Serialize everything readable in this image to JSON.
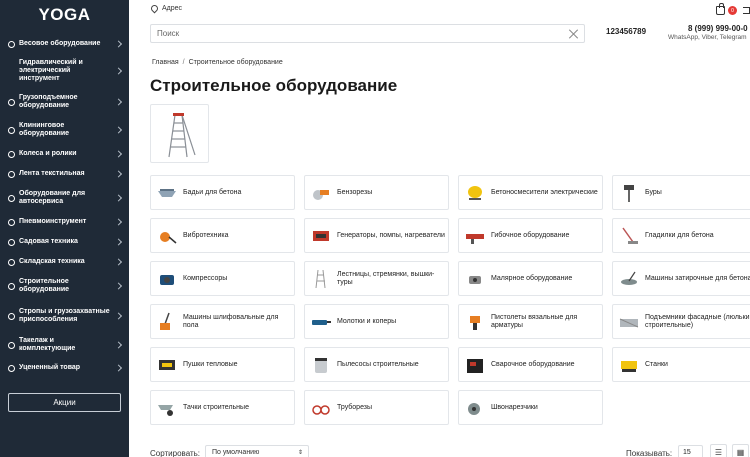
{
  "sidebar": {
    "logo": "YOGA",
    "items": [
      {
        "label": "Весовое оборудование"
      },
      {
        "label": "Гидравлический и электрический инструмент"
      },
      {
        "label": "Грузоподъемное оборудование"
      },
      {
        "label": "Клининговое оборудование"
      },
      {
        "label": "Колеса и ролики"
      },
      {
        "label": "Лента текстильная"
      },
      {
        "label": "Оборудование для автосервиса"
      },
      {
        "label": "Пневмоинструмент"
      },
      {
        "label": "Садовая техника"
      },
      {
        "label": "Складская техника"
      },
      {
        "label": "Строительное оборудование"
      },
      {
        "label": "Стропы и грузозахватные приспособления"
      },
      {
        "label": "Такелаж и комплектующие"
      },
      {
        "label": "Уцененный товар"
      }
    ],
    "promo_label": "Акции"
  },
  "header": {
    "address_label": "Адрес",
    "search_placeholder": "Поиск",
    "phone_short": "123456789",
    "phone_main": "8 (999) 999-00-0",
    "phone_note": "WhatsApp, Viber, Telegram",
    "cart_count": "0"
  },
  "breadcrumb": {
    "home": "Главная",
    "current": "Строительное оборудование"
  },
  "page_title": "Строительное оборудование",
  "categories": [
    {
      "label": "Бадьи для бетона"
    },
    {
      "label": "Бензорезы"
    },
    {
      "label": "Бетоносмесители электрические"
    },
    {
      "label": "Буры"
    },
    {
      "label": "Вибротехника"
    },
    {
      "label": "Генераторы, помпы, нагреватели"
    },
    {
      "label": "Гибочное оборудование"
    },
    {
      "label": "Гладилки для бетона"
    },
    {
      "label": "Компрессоры"
    },
    {
      "label": "Лестницы, стремянки, вышки-туры"
    },
    {
      "label": "Малярное оборудование"
    },
    {
      "label": "Машины затирочные для бетона"
    },
    {
      "label": "Машины шлифовальные для пола"
    },
    {
      "label": "Молотки и коперы"
    },
    {
      "label": "Пистолеты вязальные для арматуры"
    },
    {
      "label": "Подъемники фасадные (люльки строительные)"
    },
    {
      "label": "Пушки тепловые"
    },
    {
      "label": "Пылесосы строительные"
    },
    {
      "label": "Сварочное оборудование"
    },
    {
      "label": "Станки"
    },
    {
      "label": "Тачки строительные"
    },
    {
      "label": "Труборезы"
    },
    {
      "label": "Швонарезчики"
    }
  ],
  "toolbar": {
    "sort_label": "Сортировать:",
    "sort_value": "По умолчанию",
    "show_label": "Показывать:",
    "show_value": "15"
  }
}
